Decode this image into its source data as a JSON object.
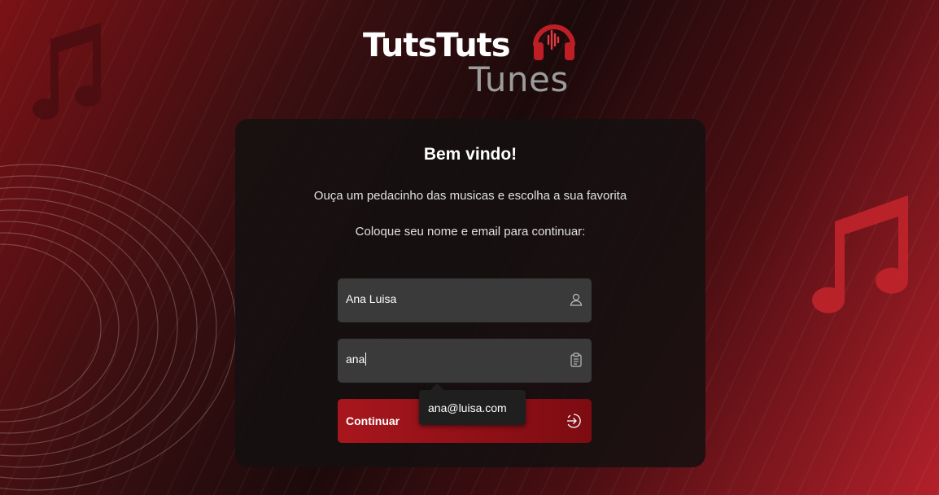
{
  "logo": {
    "line1": "TutsTuts",
    "line2": "Tunes",
    "icon": "headphone-icon"
  },
  "card": {
    "title": "Bem vindo!",
    "subtitle": "Ouça um pedacinho das musicas e escolha a sua favorita",
    "instruction": "Coloque seu nome e email para continuar:"
  },
  "form": {
    "name": {
      "value": "Ana Luisa",
      "icon": "user-icon"
    },
    "email": {
      "value": "ana",
      "icon": "clipboard-icon"
    },
    "submit": {
      "label": "Continuar",
      "icon": "enter-icon"
    },
    "autocomplete": {
      "suggestion": "ana@luisa.com"
    }
  },
  "colors": {
    "accent": "#a8161d",
    "field_bg": "#3a3a3a",
    "card_bg": "#141010"
  },
  "decorations": [
    "music-note-icon",
    "music-note-icon",
    "sound-rings"
  ]
}
